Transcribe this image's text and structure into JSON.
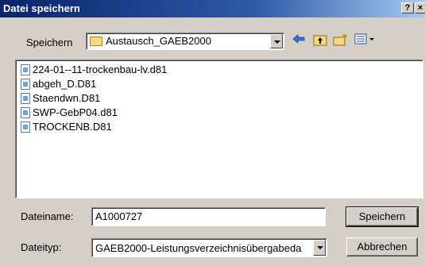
{
  "dialog": {
    "title": "Datei speichern",
    "help_button": "?",
    "close_button": "×"
  },
  "location": {
    "label": "Speichern",
    "selected_folder": "Austausch_GAEB2000"
  },
  "toolbar": {
    "back_icon": "back-arrow-icon",
    "up_icon": "folder-up-icon",
    "new_folder_icon": "new-folder-icon",
    "view_icon": "view-menu-icon"
  },
  "files": [
    {
      "name": "224-01--11-trockenbau-lv.d81"
    },
    {
      "name": "abgeh_D.D81"
    },
    {
      "name": "Staendwn.D81"
    },
    {
      "name": "SWP-GebP04.d81"
    },
    {
      "name": "TROCKENB.D81"
    }
  ],
  "filename": {
    "label": "Dateiname:",
    "value": "A1000727"
  },
  "filetype": {
    "label": "Dateityp:",
    "value": "GAEB2000-Leistungsverzeichnisübergabeda"
  },
  "buttons": {
    "save": "Speichern",
    "cancel": "Abbrechen"
  }
}
